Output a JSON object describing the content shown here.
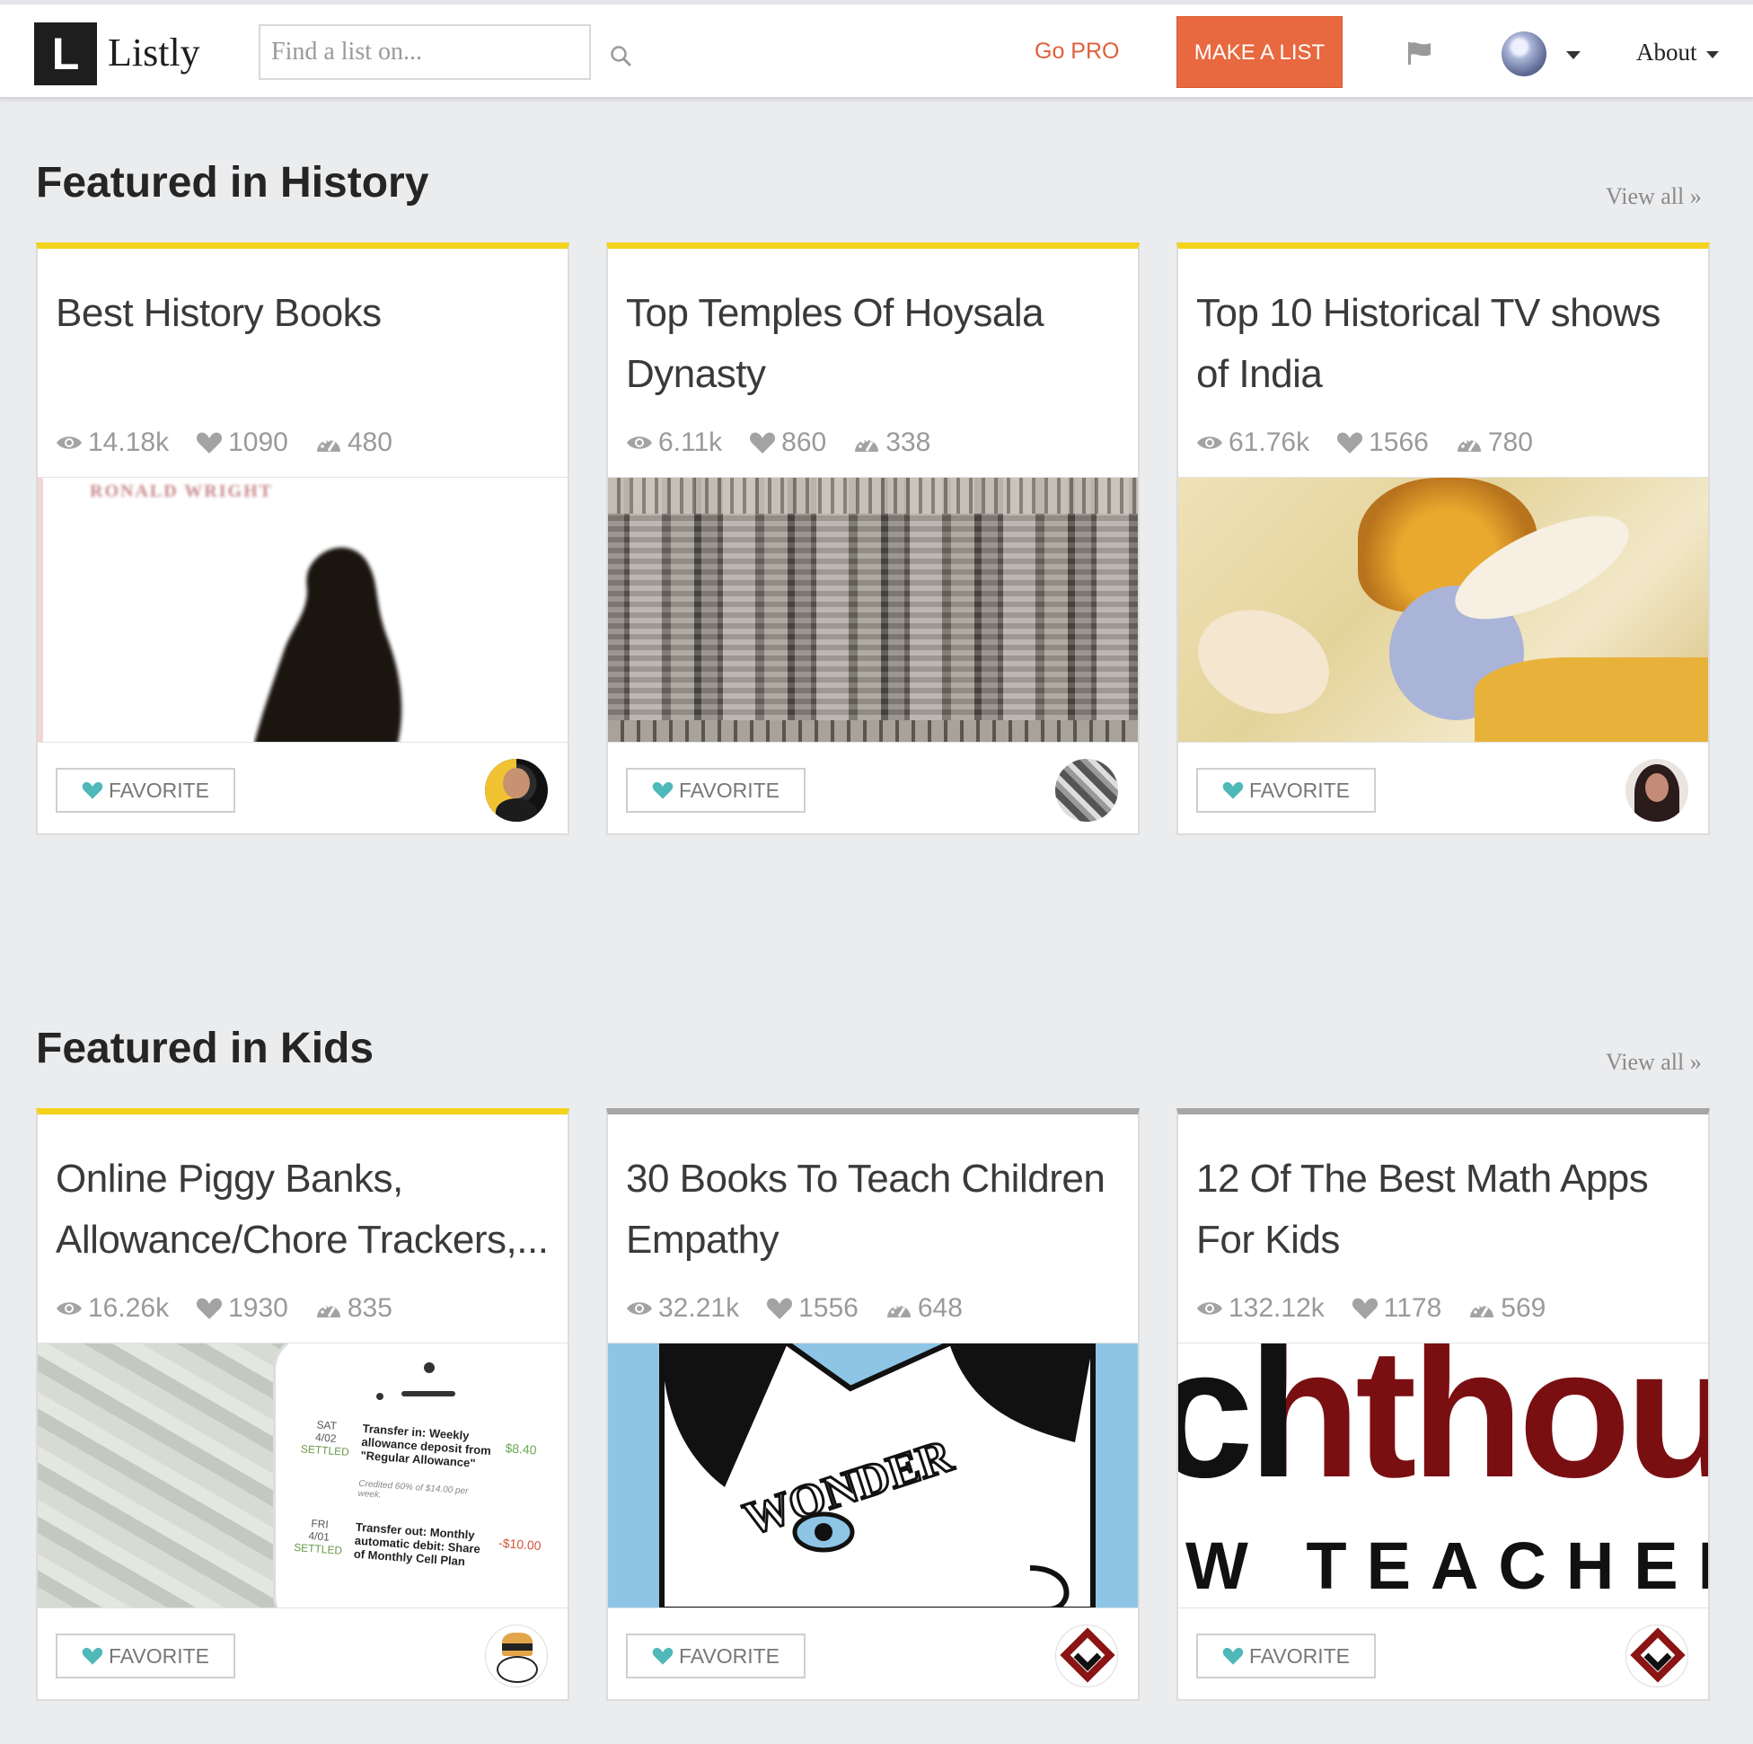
{
  "header": {
    "logo_letter": "L",
    "logo_text": "Listly",
    "search_placeholder": "Find a list on...",
    "go_pro": "Go PRO",
    "make_list": "MAKE A LIST",
    "about": "About"
  },
  "sections": [
    {
      "title": "Featured in History",
      "view_all": "View all »",
      "cards": [
        {
          "title": "Best History Books",
          "views": "14.18k",
          "likes": "1090",
          "items": "480",
          "favorite": "FAVORITE",
          "image": "book-cover-crow"
        },
        {
          "title": "Top Temples Of Hoysala Dynasty",
          "views": "6.11k",
          "likes": "860",
          "items": "338",
          "favorite": "FAVORITE",
          "image": "temple-carvings"
        },
        {
          "title": "Top 10 Historical TV shows of India",
          "views": "61.76k",
          "likes": "1566",
          "items": "780",
          "favorite": "FAVORITE",
          "image": "krishna-painting"
        }
      ]
    },
    {
      "title": "Featured in Kids",
      "view_all": "View all »",
      "cards": [
        {
          "title": "Online Piggy Banks, Allowance/Chore Trackers,...",
          "views": "16.26k",
          "likes": "1930",
          "items": "835",
          "favorite": "FAVORITE",
          "image": "money-app"
        },
        {
          "title": "30 Books To Teach Children Empathy",
          "views": "32.21k",
          "likes": "1556",
          "items": "648",
          "favorite": "FAVORITE",
          "image": "wonder-cover"
        },
        {
          "title": "12 Of The Best Math Apps For Kids",
          "views": "132.12k",
          "likes": "1178",
          "items": "569",
          "favorite": "FAVORITE",
          "image": "teacher-logo"
        }
      ]
    }
  ],
  "images": {
    "book_cover_author": "RONALD WRIGHT",
    "wonder_word": "WONDER",
    "teachthought_big": "chthou",
    "teachthought_sub": "W TEACHERS",
    "app_rows": [
      {
        "day": "SAT",
        "date": "4/02",
        "status": "SETTLED",
        "text": "Transfer in: Weekly allowance deposit from \"Regular Allowance\"",
        "sub": "Credited 60% of $14.00 per week.",
        "amount": "$8.40"
      },
      {
        "day": "FRI",
        "date": "4/01",
        "status": "SETTLED",
        "text": "Transfer out: Monthly automatic debit: Share of Monthly Cell Plan",
        "sub": "",
        "amount": "-$10.00"
      }
    ]
  },
  "colors": {
    "accent": "#e8683f",
    "featured_border": "#f3d21c",
    "heart": "#4fb8b8"
  }
}
